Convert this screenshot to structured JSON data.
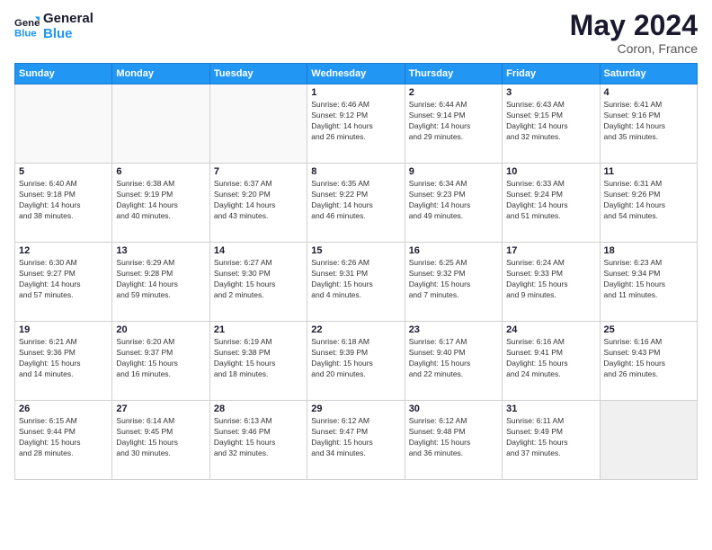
{
  "logo": {
    "line1": "General",
    "line2": "Blue"
  },
  "title": "May 2024",
  "subtitle": "Coron, France",
  "header_days": [
    "Sunday",
    "Monday",
    "Tuesday",
    "Wednesday",
    "Thursday",
    "Friday",
    "Saturday"
  ],
  "weeks": [
    [
      {
        "day": "",
        "info": ""
      },
      {
        "day": "",
        "info": ""
      },
      {
        "day": "",
        "info": ""
      },
      {
        "day": "1",
        "info": "Sunrise: 6:46 AM\nSunset: 9:12 PM\nDaylight: 14 hours\nand 26 minutes."
      },
      {
        "day": "2",
        "info": "Sunrise: 6:44 AM\nSunset: 9:14 PM\nDaylight: 14 hours\nand 29 minutes."
      },
      {
        "day": "3",
        "info": "Sunrise: 6:43 AM\nSunset: 9:15 PM\nDaylight: 14 hours\nand 32 minutes."
      },
      {
        "day": "4",
        "info": "Sunrise: 6:41 AM\nSunset: 9:16 PM\nDaylight: 14 hours\nand 35 minutes."
      }
    ],
    [
      {
        "day": "5",
        "info": "Sunrise: 6:40 AM\nSunset: 9:18 PM\nDaylight: 14 hours\nand 38 minutes."
      },
      {
        "day": "6",
        "info": "Sunrise: 6:38 AM\nSunset: 9:19 PM\nDaylight: 14 hours\nand 40 minutes."
      },
      {
        "day": "7",
        "info": "Sunrise: 6:37 AM\nSunset: 9:20 PM\nDaylight: 14 hours\nand 43 minutes."
      },
      {
        "day": "8",
        "info": "Sunrise: 6:35 AM\nSunset: 9:22 PM\nDaylight: 14 hours\nand 46 minutes."
      },
      {
        "day": "9",
        "info": "Sunrise: 6:34 AM\nSunset: 9:23 PM\nDaylight: 14 hours\nand 49 minutes."
      },
      {
        "day": "10",
        "info": "Sunrise: 6:33 AM\nSunset: 9:24 PM\nDaylight: 14 hours\nand 51 minutes."
      },
      {
        "day": "11",
        "info": "Sunrise: 6:31 AM\nSunset: 9:26 PM\nDaylight: 14 hours\nand 54 minutes."
      }
    ],
    [
      {
        "day": "12",
        "info": "Sunrise: 6:30 AM\nSunset: 9:27 PM\nDaylight: 14 hours\nand 57 minutes."
      },
      {
        "day": "13",
        "info": "Sunrise: 6:29 AM\nSunset: 9:28 PM\nDaylight: 14 hours\nand 59 minutes."
      },
      {
        "day": "14",
        "info": "Sunrise: 6:27 AM\nSunset: 9:30 PM\nDaylight: 15 hours\nand 2 minutes."
      },
      {
        "day": "15",
        "info": "Sunrise: 6:26 AM\nSunset: 9:31 PM\nDaylight: 15 hours\nand 4 minutes."
      },
      {
        "day": "16",
        "info": "Sunrise: 6:25 AM\nSunset: 9:32 PM\nDaylight: 15 hours\nand 7 minutes."
      },
      {
        "day": "17",
        "info": "Sunrise: 6:24 AM\nSunset: 9:33 PM\nDaylight: 15 hours\nand 9 minutes."
      },
      {
        "day": "18",
        "info": "Sunrise: 6:23 AM\nSunset: 9:34 PM\nDaylight: 15 hours\nand 11 minutes."
      }
    ],
    [
      {
        "day": "19",
        "info": "Sunrise: 6:21 AM\nSunset: 9:36 PM\nDaylight: 15 hours\nand 14 minutes."
      },
      {
        "day": "20",
        "info": "Sunrise: 6:20 AM\nSunset: 9:37 PM\nDaylight: 15 hours\nand 16 minutes."
      },
      {
        "day": "21",
        "info": "Sunrise: 6:19 AM\nSunset: 9:38 PM\nDaylight: 15 hours\nand 18 minutes."
      },
      {
        "day": "22",
        "info": "Sunrise: 6:18 AM\nSunset: 9:39 PM\nDaylight: 15 hours\nand 20 minutes."
      },
      {
        "day": "23",
        "info": "Sunrise: 6:17 AM\nSunset: 9:40 PM\nDaylight: 15 hours\nand 22 minutes."
      },
      {
        "day": "24",
        "info": "Sunrise: 6:16 AM\nSunset: 9:41 PM\nDaylight: 15 hours\nand 24 minutes."
      },
      {
        "day": "25",
        "info": "Sunrise: 6:16 AM\nSunset: 9:43 PM\nDaylight: 15 hours\nand 26 minutes."
      }
    ],
    [
      {
        "day": "26",
        "info": "Sunrise: 6:15 AM\nSunset: 9:44 PM\nDaylight: 15 hours\nand 28 minutes."
      },
      {
        "day": "27",
        "info": "Sunrise: 6:14 AM\nSunset: 9:45 PM\nDaylight: 15 hours\nand 30 minutes."
      },
      {
        "day": "28",
        "info": "Sunrise: 6:13 AM\nSunset: 9:46 PM\nDaylight: 15 hours\nand 32 minutes."
      },
      {
        "day": "29",
        "info": "Sunrise: 6:12 AM\nSunset: 9:47 PM\nDaylight: 15 hours\nand 34 minutes."
      },
      {
        "day": "30",
        "info": "Sunrise: 6:12 AM\nSunset: 9:48 PM\nDaylight: 15 hours\nand 36 minutes."
      },
      {
        "day": "31",
        "info": "Sunrise: 6:11 AM\nSunset: 9:49 PM\nDaylight: 15 hours\nand 37 minutes."
      },
      {
        "day": "",
        "info": ""
      }
    ]
  ]
}
